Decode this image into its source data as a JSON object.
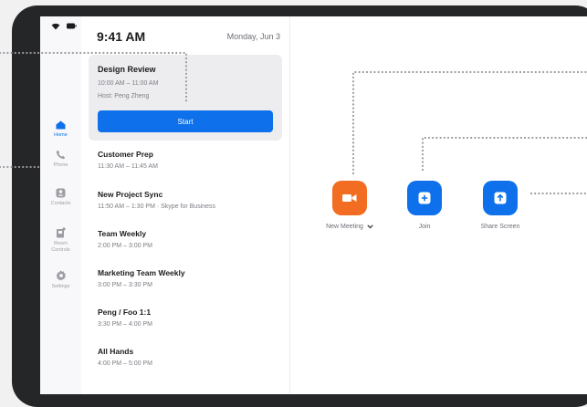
{
  "status_bar": {
    "wifi_icon": "wifi-icon",
    "battery_icon": "battery-icon"
  },
  "header": {
    "time": "9:41 AM",
    "date": "Monday, Jun 3"
  },
  "nav": [
    {
      "label": "Home",
      "icon": "home-icon",
      "active": true
    },
    {
      "label": "Phone",
      "icon": "phone-icon",
      "active": false
    },
    {
      "label": "Contacts",
      "icon": "contacts-icon",
      "active": false
    },
    {
      "label": "Room Controls",
      "icon": "room-controls-icon",
      "active": false
    },
    {
      "label": "Settings",
      "icon": "gear-icon",
      "active": false
    }
  ],
  "featured": {
    "title": "Design Review",
    "time": "10:00 AM – 11:00 AM",
    "host": "Host: Peng Zheng",
    "button": "Start"
  },
  "meetings": [
    {
      "title": "Customer Prep",
      "time": "11:30 AM – 11:45 AM"
    },
    {
      "title": "New Project Sync",
      "time": "11:50 AM – 1:30 PM · Skype for Business"
    },
    {
      "title": "Team Weekly",
      "time": "2:00 PM – 3:00 PM"
    },
    {
      "title": "Marketing Team Weekly",
      "time": "3:00 PM – 3:30 PM"
    },
    {
      "title": "Peng / Foo 1:1",
      "time": "3:30 PM – 4:00 PM"
    },
    {
      "title": "All Hands",
      "time": "4:00 PM – 5:00 PM"
    }
  ],
  "actions": {
    "new_meeting": {
      "label": "New Meeting",
      "icon": "video-camera-icon",
      "color": "#f26d21"
    },
    "join": {
      "label": "Join",
      "icon": "plus-icon",
      "color": "#0e71eb"
    },
    "share": {
      "label": "Share Screen",
      "icon": "upload-arrow-icon",
      "color": "#0e71eb"
    }
  },
  "colors": {
    "accent": "#0e71eb",
    "orange": "#f26d21",
    "frame": "#252628",
    "callout": "#9a9aa0"
  }
}
